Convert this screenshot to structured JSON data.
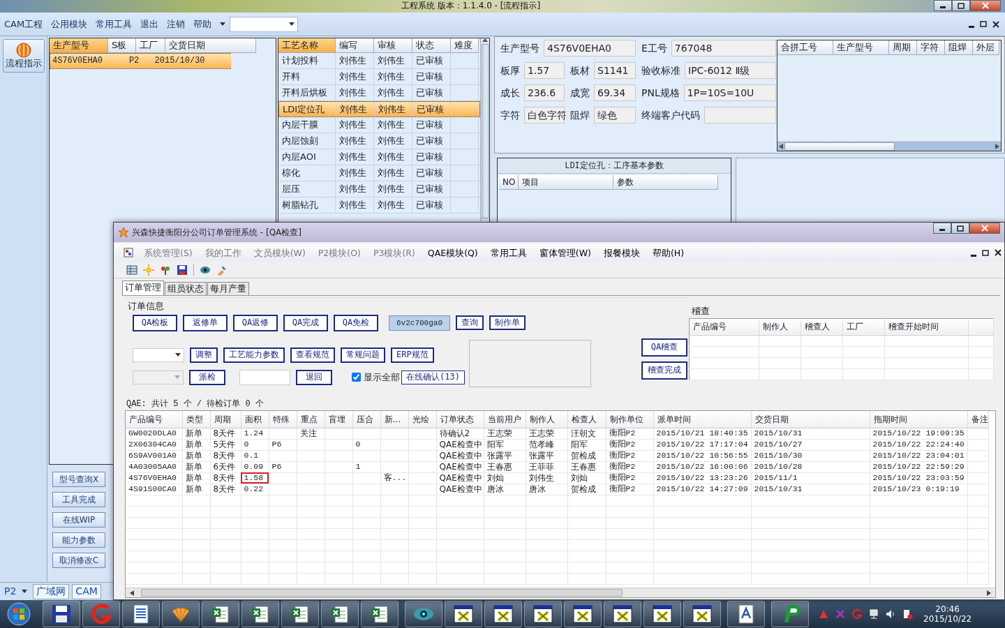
{
  "back_window": {
    "title": "工程系统  版本：1.1.4.0 - [流程指示]",
    "menu": [
      "CAM工程",
      "公用模块",
      "常用工具",
      "退出",
      "注销",
      "帮助"
    ],
    "nav_button": "流程指示",
    "order_list": {
      "columns": [
        "生产型号",
        "S板",
        "工厂",
        "交货日期"
      ],
      "rows": [
        {
          "cells": [
            "4S76V0EHA0",
            null,
            "P2",
            "2015/10/30"
          ],
          "selected": true
        }
      ]
    },
    "side_buttons": [
      "型号查询X",
      "工具完成",
      "在线WIP",
      "能力参数",
      "取消修改C"
    ],
    "factory": "P2",
    "bottom_tabs": [
      "广域网",
      "CAM"
    ],
    "process_list": {
      "columns": [
        "工艺名称",
        "编写",
        "审核",
        "状态",
        "难度"
      ],
      "rows": [
        {
          "cells": [
            "计划投料",
            "刘伟生",
            "刘伟生",
            "已审核"
          ],
          "selected": false
        },
        {
          "cells": [
            "开料",
            "刘伟生",
            "刘伟生",
            "已审核"
          ],
          "selected": false
        },
        {
          "cells": [
            "开料后烘板",
            "刘伟生",
            "刘伟生",
            "已审核"
          ],
          "selected": false
        },
        {
          "cells": [
            "LDI定位孔",
            "刘伟生",
            "刘伟生",
            "已审核"
          ],
          "selected": true
        },
        {
          "cells": [
            "内层干膜",
            "刘伟生",
            "刘伟生",
            "已审核"
          ],
          "selected": false
        },
        {
          "cells": [
            "内层蚀刻",
            "刘伟生",
            "刘伟生",
            "已审核"
          ],
          "selected": false
        },
        {
          "cells": [
            "内层AOI",
            "刘伟生",
            "刘伟生",
            "已审核"
          ],
          "selected": false
        },
        {
          "cells": [
            "棕化",
            "刘伟生",
            "刘伟生",
            "已审核"
          ],
          "selected": false
        },
        {
          "cells": [
            "层压",
            "刘伟生",
            "刘伟生",
            "已审核"
          ],
          "selected": false
        },
        {
          "cells": [
            "树脂钻孔",
            "刘伟生",
            "刘伟生",
            "已审核"
          ],
          "selected": false
        }
      ]
    },
    "details": [
      [
        {
          "label": "生产型号",
          "value": "4S76V0EHA0"
        },
        {
          "label": "E工号",
          "value": "767048"
        }
      ],
      [
        {
          "label": "板厚",
          "value": "1.57"
        },
        {
          "label": "板材",
          "value": "S1141"
        },
        {
          "label": "验收标准",
          "value": "IPC-6012 Ⅱ级"
        }
      ],
      [
        {
          "label": "成长",
          "value": "236.6"
        },
        {
          "label": "成宽",
          "value": "69.34"
        },
        {
          "label": "PNL规格",
          "value": "1P=10S=10U"
        }
      ],
      [
        {
          "label": "字符",
          "value": "白色字符"
        },
        {
          "label": "阻焊",
          "value": "绿色"
        },
        {
          "label": "终端客户代码"
        }
      ]
    ],
    "merge_table": {
      "columns": [
        "合拼工号",
        "生产型号",
        "周期",
        "字符",
        "阻焊",
        "外层"
      ]
    },
    "params_panel": {
      "title": "LDI定位孔：工序基本参数",
      "columns": [
        "NO",
        "项目",
        "参数"
      ]
    }
  },
  "front_window": {
    "title": "兴森快捷衡阳分公司订单管理系统 - [QA检查]",
    "menu": [
      {
        "label": "系统管理(S)",
        "disabled": true
      },
      {
        "label": "我的工作",
        "disabled": true
      },
      {
        "label": "文员模块(W)",
        "disabled": true
      },
      {
        "label": "P2模块(O)",
        "disabled": true
      },
      {
        "label": "P3模块(R)",
        "disabled": true
      },
      {
        "label": "QAE模块(Q)",
        "disabled": false
      },
      {
        "label": "常用工具",
        "disabled": false
      },
      {
        "label": "窗体管理(W)",
        "disabled": false
      },
      {
        "label": "报餐模块",
        "disabled": false
      },
      {
        "label": "帮助(H)",
        "disabled": false
      }
    ],
    "tabs": [
      {
        "label": "订单管理",
        "selected": true
      },
      {
        "label": "组员状态",
        "selected": false
      },
      {
        "label": "每月产量",
        "selected": false
      }
    ],
    "group_title": "订单信息",
    "action_buttons": [
      "QA检板",
      "返修单",
      "QA返修",
      "QA完成",
      "QA免检"
    ],
    "search_value": "6v2c700ga0",
    "query_buttons": [
      "查询",
      "制作单"
    ],
    "tool_buttons": [
      "调整",
      "工艺能力参数",
      "查看规范",
      "常规问题",
      "ERP规范"
    ],
    "dispatch_button": "派检",
    "return_button": "退回",
    "show_all": {
      "label": "显示全部",
      "checked": true
    },
    "online_button": "在线确认(13)",
    "audit_buttons": [
      "QA稽查",
      "稽查完成"
    ],
    "audit": {
      "title": "稽查",
      "columns": [
        "产品编号",
        "制作人",
        "稽查人",
        "工厂",
        "稽查开始时间"
      ]
    },
    "summary": "QAE: 共计 5 个 / 待检订单 0 个",
    "orders": {
      "columns": [
        "产品编号",
        "类型",
        "周期",
        "面积",
        "特殊",
        "重点",
        "盲埋",
        "压合",
        "新...",
        "光绘",
        "订单状态",
        "当前用户",
        "制作人",
        "检查人",
        "制作单位",
        "派单时间",
        "交货日期",
        "拖期时间",
        "备注"
      ],
      "rows": [
        {
          "cells": [
            "GW0020DLA0",
            "新单",
            "8天件",
            "1.24",
            null,
            "关注",
            null,
            null,
            null,
            null,
            "待确认2",
            "王志荣",
            "王志荣",
            "汪朝文",
            "衡阳P2",
            "2015/10/21 18:40:35",
            "2015/10/31",
            "2015/10/22 19:09:35",
            null
          ],
          "flagged": false
        },
        {
          "cells": [
            "2X06304CA0",
            "新单",
            "5天件",
            "0",
            "P6",
            null,
            null,
            "0",
            null,
            null,
            "QAE检查中",
            "阳军",
            "范孝峰",
            "阳军",
            "衡阳P2",
            "2015/10/22 17:17:04",
            "2015/10/27",
            "2015/10/22 22:24:40",
            null
          ],
          "flagged": false
        },
        {
          "cells": [
            "6S9AV001A0",
            "新单",
            "8天件",
            "0.1",
            null,
            null,
            null,
            null,
            null,
            null,
            "QAE检查中",
            "张露平",
            "张露平",
            "贺检成",
            "衡阳P2",
            "2015/10/22 10:56:55",
            "2015/10/30",
            "2015/10/22 23:04:01",
            null
          ],
          "flagged": false
        },
        {
          "cells": [
            "4A03005AA0",
            "新单",
            "6天件",
            "0.09",
            "P6",
            null,
            null,
            "1",
            null,
            null,
            "QAE检查中",
            "王春惠",
            "王菲菲",
            "王春惠",
            "衡阳P2",
            "2015/10/22 16:00:06",
            "2015/10/28",
            "2015/10/22 22:59:29",
            null
          ],
          "flagged": false
        },
        {
          "cells": [
            "4S76V0EHA0",
            "新单",
            "8天件",
            "1.58",
            null,
            null,
            null,
            null,
            "客...",
            null,
            "QAE检查中",
            "刘灿",
            "刘伟生",
            "刘灿",
            "衡阳P2",
            "2015/10/22 13:23:26",
            "2015/11/1",
            "2015/10/22 23:03:59",
            null
          ],
          "flagged": true
        },
        {
          "cells": [
            "4S91S00CA0",
            "新单",
            "8天件",
            "0.22",
            null,
            null,
            null,
            null,
            null,
            null,
            "QAE检查中",
            "唐冰",
            "唐冰",
            "贺检成",
            "衡阳P2",
            "2015/10/22 14:27:09",
            "2015/10/31",
            "2015/10/23 0:19:19",
            null
          ],
          "flagged": false
        }
      ]
    }
  },
  "taskbar": {
    "time": "20:46",
    "date": "2015/10/22"
  }
}
